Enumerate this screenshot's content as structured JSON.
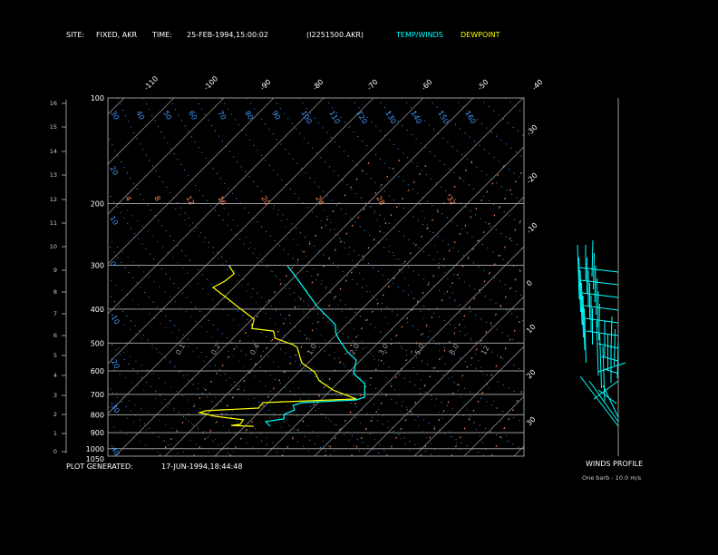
{
  "header": {
    "site_label": "SITE:",
    "site_value": "FIXED, AKR",
    "time_label": "TIME:",
    "time_value": "25-FEB-1994,15:00:02",
    "file": "(I2251500.AKR)",
    "legend_temp": "TEMP/WINDS",
    "legend_dew": "DEWPOINT"
  },
  "footer": {
    "generated_label": "PLOT GENERATED:",
    "generated_value": "17-JUN-1994,18:44:48"
  },
  "winds": {
    "title": "WINDS PROFILE",
    "note": "One barb - 10.0 m/s"
  },
  "colors": {
    "temp": "#00ffff",
    "dewpoint": "#ffff00",
    "dry_adiabat": "#4499ff",
    "mixing": "#ff8855",
    "grid": "#999999"
  },
  "chart_data": {
    "type": "line",
    "title": "Skew-T Log-P sounding",
    "pressure_levels": [
      100,
      200,
      300,
      400,
      500,
      600,
      700,
      800,
      900,
      1000,
      1050
    ],
    "pressure_labels": [
      "100",
      "200",
      "300",
      "400",
      "500",
      "600",
      "700",
      "800",
      "900",
      "1000",
      "1050"
    ],
    "height_km_ticks": [
      "0",
      "1",
      "2",
      "3",
      "4",
      "5",
      "6",
      "7",
      "8",
      "9",
      "10",
      "11",
      "12",
      "13",
      "14",
      "15",
      "16"
    ],
    "isotherm_top_labels": [
      "-110",
      "-100",
      "-90",
      "-80",
      "-70",
      "-60",
      "-50",
      "-40"
    ],
    "isotherm_right_labels": [
      "-30",
      "-20",
      "-10",
      "0",
      "10",
      "20",
      "30"
    ],
    "dry_adiabat_top_labels": [
      "30",
      "40",
      "50",
      "60",
      "70",
      "80",
      "90",
      "100",
      "110",
      "120",
      "130",
      "140",
      "150",
      "160"
    ],
    "dry_adiabat_left_labels": [
      "20",
      "10",
      "0",
      "-10",
      "-20",
      "-30",
      "-40"
    ],
    "orange_labels": [
      "4",
      "8",
      "12",
      "16",
      "20",
      "24",
      "28",
      "32"
    ],
    "mixing_ratio_labels": [
      "0.1",
      "0.2",
      "0.4",
      "1.0",
      "2.0",
      "3.0",
      "5.0",
      "8.0",
      "12"
    ],
    "ylim_hpa": [
      1050,
      100
    ],
    "series": [
      {
        "name": "TEMP/WINDS",
        "points": [
          [
            301,
            -53.6
          ],
          [
            333,
            -48.2
          ],
          [
            393,
            -39.5
          ],
          [
            443,
            -32.2
          ],
          [
            467,
            -30.5
          ],
          [
            484,
            -28.9
          ],
          [
            529,
            -24.4
          ],
          [
            559,
            -20.9
          ],
          [
            611,
            -18.7
          ],
          [
            652,
            -14.5
          ],
          [
            713,
            -11.8
          ],
          [
            726,
            -12.9
          ],
          [
            739,
            -23.3
          ],
          [
            752,
            -24.5
          ],
          [
            775,
            -23.3
          ],
          [
            798,
            -24.5
          ],
          [
            822,
            -23.6
          ],
          [
            837,
            -26.7
          ],
          [
            863,
            -24.9
          ]
        ]
      },
      {
        "name": "DEWPOINT",
        "points": [
          [
            301,
            -65.3
          ],
          [
            317,
            -62.7
          ],
          [
            333,
            -63.1
          ],
          [
            347,
            -64.2
          ],
          [
            368,
            -60.0
          ],
          [
            393,
            -55.5
          ],
          [
            427,
            -49.6
          ],
          [
            454,
            -48.2
          ],
          [
            462,
            -43.3
          ],
          [
            484,
            -41.6
          ],
          [
            505,
            -36.7
          ],
          [
            514,
            -35.3
          ],
          [
            569,
            -31.3
          ],
          [
            604,
            -26.9
          ],
          [
            640,
            -24.2
          ],
          [
            680,
            -19.6
          ],
          [
            700,
            -16.4
          ],
          [
            721,
            -13.1
          ],
          [
            739,
            -31.1
          ],
          [
            766,
            -30.9
          ],
          [
            779,
            -40.9
          ],
          [
            789,
            -41.8
          ],
          [
            808,
            -38.0
          ],
          [
            827,
            -31.6
          ],
          [
            852,
            -31.3
          ],
          [
            858,
            -32.9
          ],
          [
            863,
            -28.2
          ]
        ]
      }
    ]
  }
}
